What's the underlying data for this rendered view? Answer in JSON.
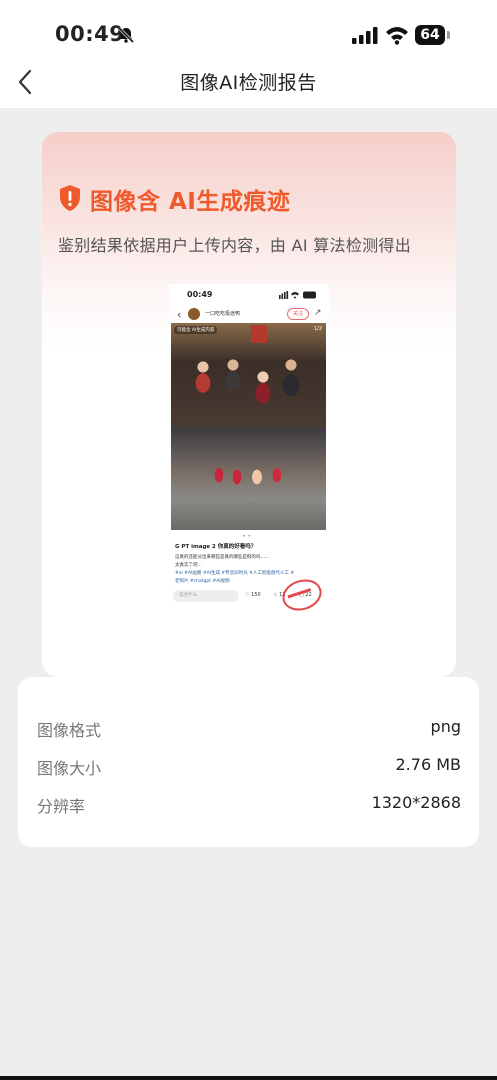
{
  "status_bar": {
    "time": "00:49",
    "battery": "64"
  },
  "nav": {
    "title": "图像AI检测报告"
  },
  "result": {
    "title": "图像含 AI生成痕迹",
    "description": "鉴别结果依据用户上传内容，由 AI 算法检测得出",
    "accent_color": "#ee5a2b"
  },
  "screenshot": {
    "time": "00:49",
    "username": "一口吃吃极途鸭",
    "follow_label": "关注",
    "ai_tag": "可能含 AI生成内容",
    "page_indicator": "1/2",
    "headline": "G PT image 2 你真的好看吗？",
    "body_lines": [
      "这真的还能分出来哪些是真的哪些是假的吗……",
      "太真实了吧…"
    ],
    "tag_lines": [
      "#ai #AI画图 #AI生成 #怀念旧时光 #人工智能替代人工 #",
      "老照片 #chatgpt #AI视频"
    ],
    "comment_placeholder": "说点什么…",
    "likes": "150",
    "stars": "11",
    "comments": "22"
  },
  "details": [
    {
      "label": "图像格式",
      "value": "png"
    },
    {
      "label": "图像大小",
      "value": "2.76 MB"
    },
    {
      "label": "分辨率",
      "value": "1320*2868"
    }
  ]
}
